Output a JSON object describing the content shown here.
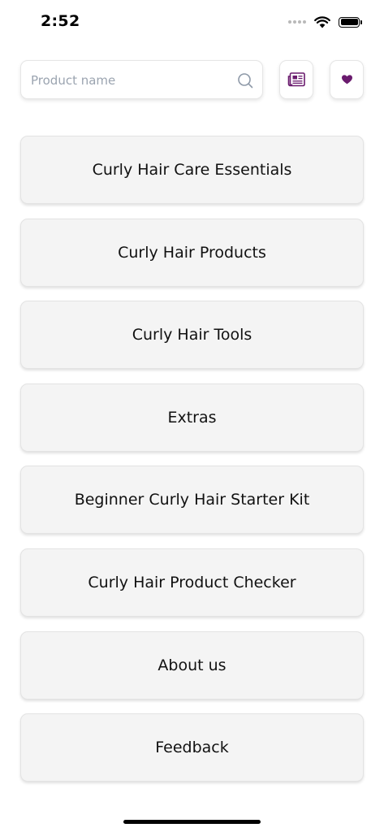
{
  "status_bar": {
    "time": "2:52"
  },
  "search": {
    "placeholder": "Product name",
    "value": "",
    "icon": "search-icon"
  },
  "actions": {
    "news_icon": "newspaper-icon",
    "favorites_icon": "heart-icon"
  },
  "colors": {
    "accent": "#6a1b6e",
    "card_background": "#f4f4f4",
    "placeholder": "#9ba4b0"
  },
  "menu": {
    "items": [
      {
        "label": "Curly Hair Care Essentials"
      },
      {
        "label": "Curly Hair Products"
      },
      {
        "label": "Curly Hair Tools"
      },
      {
        "label": "Extras"
      },
      {
        "label": "Beginner Curly Hair Starter Kit"
      },
      {
        "label": "Curly Hair Product Checker"
      },
      {
        "label": "About us"
      },
      {
        "label": "Feedback"
      }
    ]
  }
}
